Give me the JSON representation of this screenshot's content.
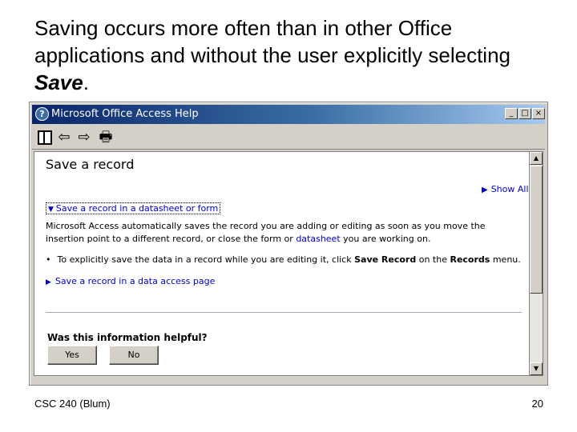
{
  "slide": {
    "title_before": "Saving occurs more often than in other Office applications and without the user explicitly selecting ",
    "title_emphasis": "Save",
    "title_after": ".",
    "footer_left": "CSC 240 (Blum)",
    "footer_right": "20"
  },
  "window": {
    "icon": "help-question-icon",
    "icon_glyph": "?",
    "title": "Microsoft Office Access Help",
    "controls": {
      "minimize": "_",
      "maximize": "□",
      "close": "×"
    }
  },
  "toolbar": {
    "buttons": [
      {
        "name": "hide-pane",
        "icon": "hide-pane-icon"
      },
      {
        "name": "back",
        "icon": "back-arrow-icon",
        "glyph": "⇦"
      },
      {
        "name": "forward",
        "icon": "forward-arrow-icon",
        "glyph": "⇨"
      },
      {
        "name": "print",
        "icon": "printer-icon",
        "glyph": "🖶"
      }
    ]
  },
  "content": {
    "topic_title": "Save a record",
    "show_all": "Show All",
    "expand_link": "Save a record in a datasheet or form",
    "paragraph_before": "Microsoft Access automatically saves the record you are adding or editing as soon as you move the insertion point to a different record, or close the form or ",
    "paragraph_link": "datasheet",
    "paragraph_after": " you are working on.",
    "bullet_before": "To explicitly save the data in a record while you are editing it, click ",
    "bullet_bold1": "Save Record",
    "bullet_mid": " on the ",
    "bullet_bold2": "Records",
    "bullet_after": " menu.",
    "related_link": "Save a record in a data access page",
    "feedback_question": "Was this information helpful?",
    "yes_button": "Yes",
    "no_button": "No"
  },
  "scrollbar": {
    "up_glyph": "▲",
    "down_glyph": "▼"
  },
  "glyphs": {
    "triangle_right": "▶",
    "triangle_down": "▼",
    "bullet": "•"
  }
}
